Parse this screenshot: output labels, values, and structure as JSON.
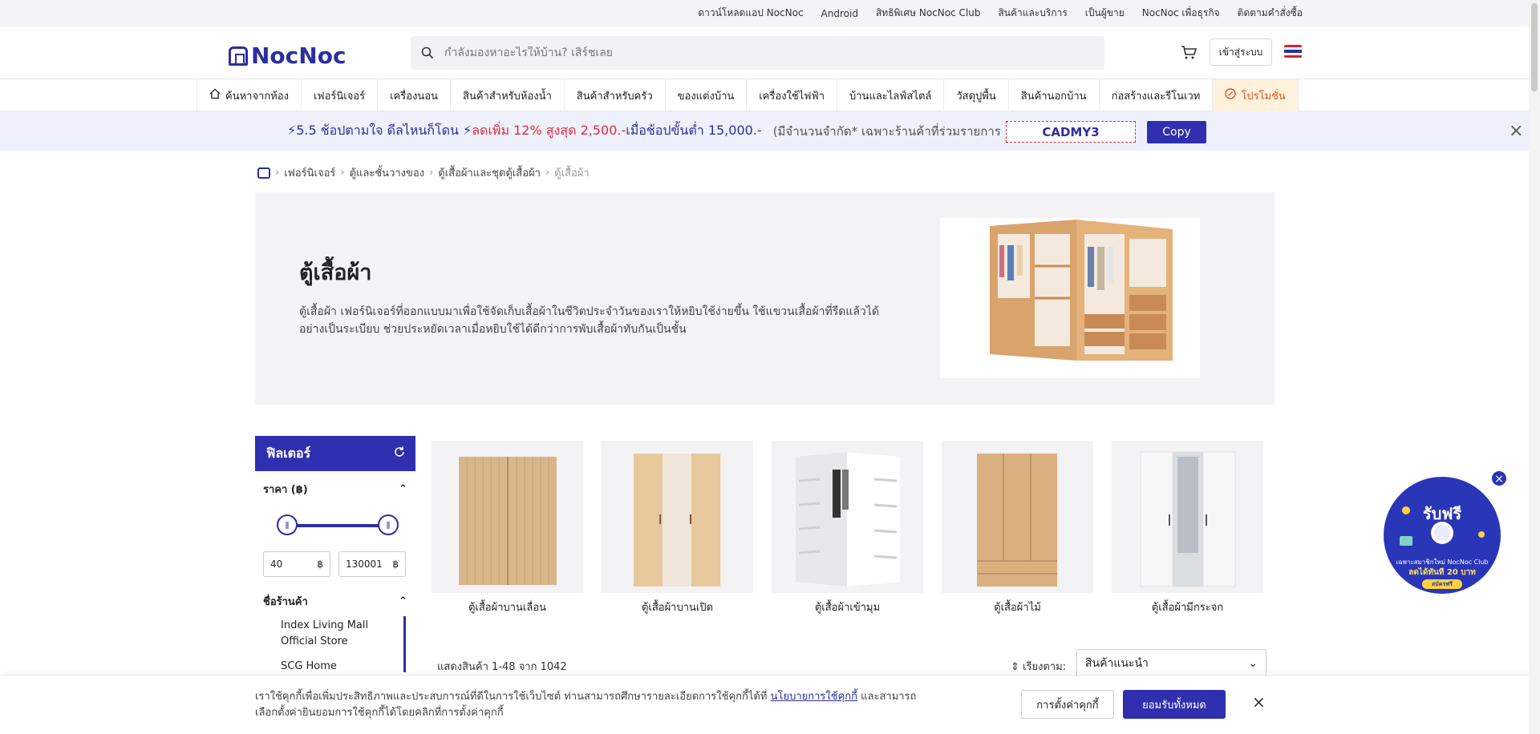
{
  "utility": {
    "items": [
      "ดาวน์โหลดแอป NocNoc",
      "Android",
      "สิทธิพิเศษ NocNoc Club",
      "สินค้าและบริการ",
      "เป็นผู้ขาย",
      "NocNoc เพื่อธุรกิจ",
      "ติดตามคำสั่งซื้อ"
    ]
  },
  "header": {
    "logo": "NocNoc",
    "search_placeholder": "กำลังมองหาอะไรให้บ้าน? เสิร์ชเลย",
    "login_label": "เข้าสู่ระบบ"
  },
  "categories": [
    "ค้นหาจากห้อง",
    "เฟอร์นิเจอร์",
    "เครื่องนอน",
    "สินค้าสำหรับห้องน้ำ",
    "สินค้าสำหรับครัว",
    "ของแต่งบ้าน",
    "เครื่องใช้ไฟฟ้า",
    "บ้านและไลฟ์สไตล์",
    "วัสดุปูพื้น",
    "สินค้านอกบ้าน",
    "ก่อสร้างและรีโนเวท",
    "โปรโมชั่น"
  ],
  "banner": {
    "part1": "⚡5.5 ช้อปตามใจ ดีลไหนก็โดน ⚡",
    "part2": "ลดเพิ่ม 12% สูงสุด 2,500.-",
    "part3": " เมื่อช้อปขั้นต่ำ 15,000.-",
    "note": "(มีจำนวนจำกัด* เฉพาะร้านค้าที่ร่วมรายการ )",
    "code": "CADMY3",
    "copy_label": "Copy"
  },
  "breadcrumb": [
    "เฟอร์นิเจอร์",
    "ตู้และชั้นวางของ",
    "ตู้เสื้อผ้าและชุดตู้เสื้อผ้า",
    "ตู้เสื้อผ้า"
  ],
  "hero": {
    "title": "ตู้เสื้อผ้า",
    "description": "ตู้เสื้อผ้า เฟอร์นิเจอร์ที่ออกแบบมาเพื่อใช้จัดเก็บเสื้อผ้าในชีวิตประจำวันของเราให้หยิบใช้ง่ายขึ้น ใช้แขวนเสื้อผ้าที่รีดแล้วได้อย่างเป็นระเบียบ ช่วยประหยัดเวลาเมื่อหยิบใช้ได้ดีกว่าการพับเสื้อผ้าทับกันเป็นชั้น"
  },
  "filter": {
    "title": "ฟิลเตอร์",
    "price_label": "ราคา (฿)",
    "price_min": "40",
    "price_max": "130001",
    "currency": "฿",
    "store_label": "ชื่อร้านค้า",
    "stores": [
      "Index Living Mall Official Store",
      "SCG Home"
    ]
  },
  "products": [
    {
      "name": "ตู้เสื้อผ้าบานเลื่อน"
    },
    {
      "name": "ตู้เสื้อผ้าบานเปิด"
    },
    {
      "name": "ตู้เสื้อผ้าเข้ามุม"
    },
    {
      "name": "ตู้เสื้อผ้าไม้"
    },
    {
      "name": "ตู้เสื้อผ้ามีกระจก"
    }
  ],
  "listing": {
    "count_text": "แสดงสินค้า 1-48 จาก 1042",
    "sort_label": "เรียงตาม:",
    "sort_value": "สินค้าแนะนำ"
  },
  "cookie": {
    "text1": "เราใช้คุกกี้เพื่อเพิ่มประสิทธิภาพและประสบการณ์ที่ดีในการใช้เว็บไซต์ ท่านสามารถศึกษารายละเอียดการใช้คุกกี้ได้ที่ ",
    "link": "นโยบายการใช้คุกกี้",
    "text2": " และสามารถเลือกตั้งค่ายินยอมการใช้คุกกี้ได้โดยคลิกที่การตั้งค่าคุกกี้",
    "settings_label": "การตั้งค่าคุกกี้",
    "accept_label": "ยอมรับทั้งหมด"
  },
  "promo_badge": {
    "title": "รับฟรี",
    "line1": "เฉพาะสมาชิกใหม่ NocNoc Club",
    "line2": "ลดได้ทันที 20 บาท",
    "cta": "สมัครฟรี"
  },
  "colors": {
    "brand": "#2f2fb0",
    "promo": "#e2522a",
    "hot": "#e02d3c"
  }
}
